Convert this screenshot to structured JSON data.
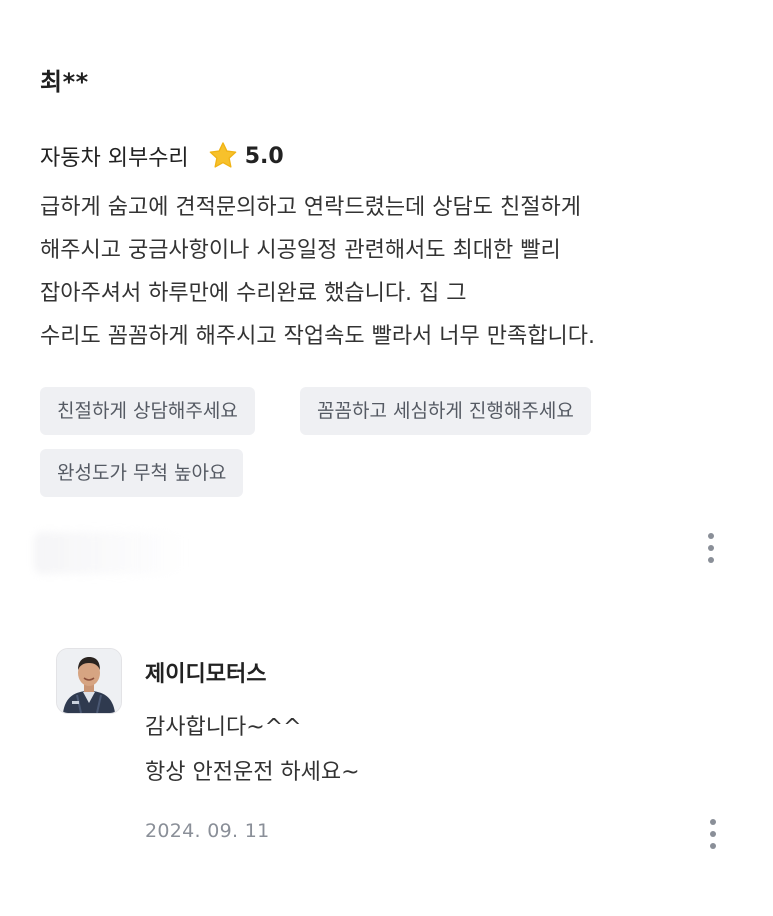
{
  "review": {
    "reviewer_name": "최**",
    "service_name": "자동차 외부수리",
    "rating": "5.0",
    "body_lines": [
      "급하게 숨고에 견적문의하고 연락드렸는데 상담도 친절하게",
      "해주시고 궁금사항이나 시공일정 관련해서도 최대한 빨리",
      "잡아주셔서 하루만에 수리완료 했습니다. 집 그",
      "수리도 꼼꼼하게 해주시고 작업속도 빨라서 너무 만족합니다."
    ],
    "tags": [
      "친절하게 상담해주세요",
      "꼼꼼하고 세심하게 진행해주세요",
      "완성도가 무척 높아요"
    ]
  },
  "reply": {
    "provider_name": "제이디모터스",
    "body_lines": [
      "감사합니다~^^",
      "항상 안전운전 하세요~"
    ],
    "date": "2024. 09. 11"
  },
  "icons": {
    "star": "star-icon",
    "more": "more-vertical-icon",
    "avatar": "provider-avatar"
  },
  "colors": {
    "star": "#F7C12B",
    "tag_background": "#EFF0F3",
    "tag_text": "#555A63",
    "muted_text": "#8A8F98"
  }
}
